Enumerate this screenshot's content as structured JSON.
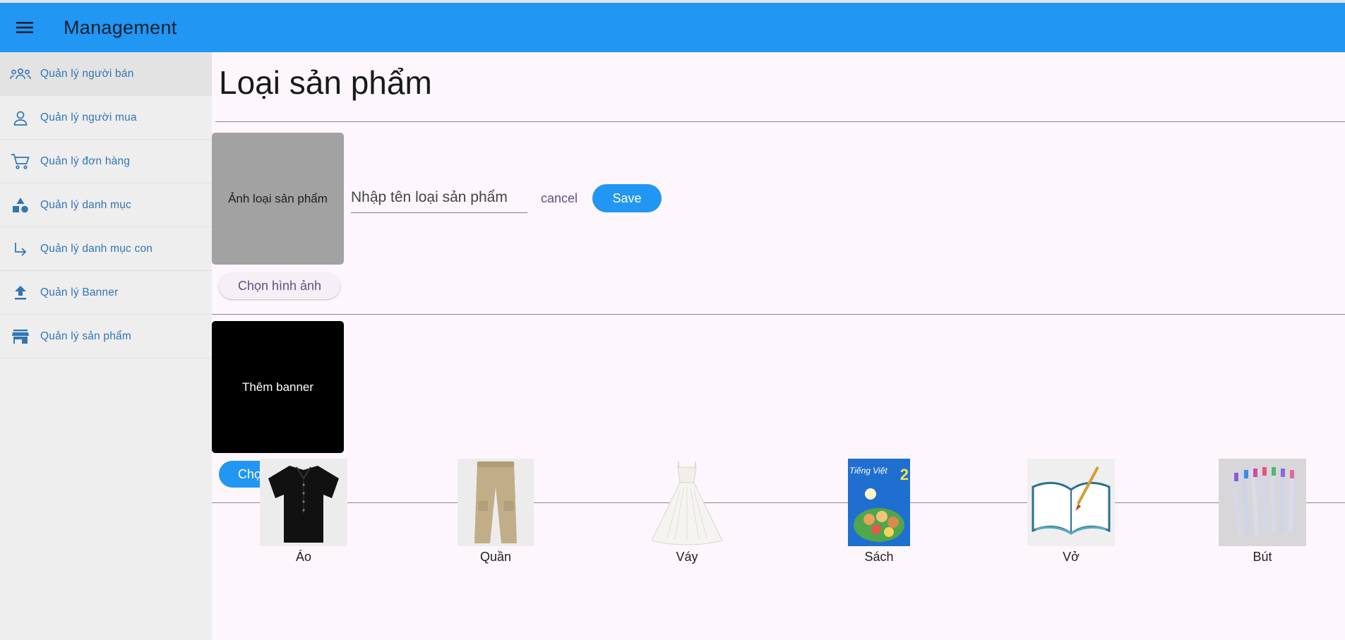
{
  "appbar": {
    "title": "Management"
  },
  "sidebar": {
    "items": [
      {
        "label": "Quản lý người bán",
        "icon": "users-group-icon"
      },
      {
        "label": "Quản lý người mua",
        "icon": "person-icon"
      },
      {
        "label": "Quản lý đơn hàng",
        "icon": "cart-icon"
      },
      {
        "label": "Quản lý danh mục",
        "icon": "shapes-icon"
      },
      {
        "label": "Quản lý danh mục con",
        "icon": "subdirectory-arrow-icon"
      },
      {
        "label": "Quản lý Banner",
        "icon": "upload-icon"
      },
      {
        "label": "Quản lý sản phẩm",
        "icon": "store-icon"
      }
    ]
  },
  "main": {
    "title": "Loại sản phẩm",
    "category_form": {
      "image_placeholder": "Ảnh loại sản phẩm",
      "pick_image_label": "Chọn hình ảnh",
      "name_placeholder": "Nhập tên loại sản phẩm",
      "cancel_label": "cancel",
      "save_label": "Save"
    },
    "banner_form": {
      "image_label": "Thêm banner",
      "pick_image_label": "Chọn hình ảnh"
    },
    "categories": [
      {
        "label": "Áo",
        "icon": "shirt-icon"
      },
      {
        "label": "Quần",
        "icon": "pants-icon"
      },
      {
        "label": "Váy",
        "icon": "dress-icon"
      },
      {
        "label": "Sách",
        "icon": "book-cover-icon",
        "cover_title": "Tiếng Việt",
        "cover_number": "2"
      },
      {
        "label": "Vở",
        "icon": "notebook-icon"
      },
      {
        "label": "Bút",
        "icon": "pens-icon"
      }
    ]
  },
  "colors": {
    "appbar": "#2196f3",
    "sidebar_bg": "#eeeeee",
    "sidebar_text": "#3275b3",
    "main_bg": "#fdf7fd",
    "primary_button": "#2196f3"
  }
}
